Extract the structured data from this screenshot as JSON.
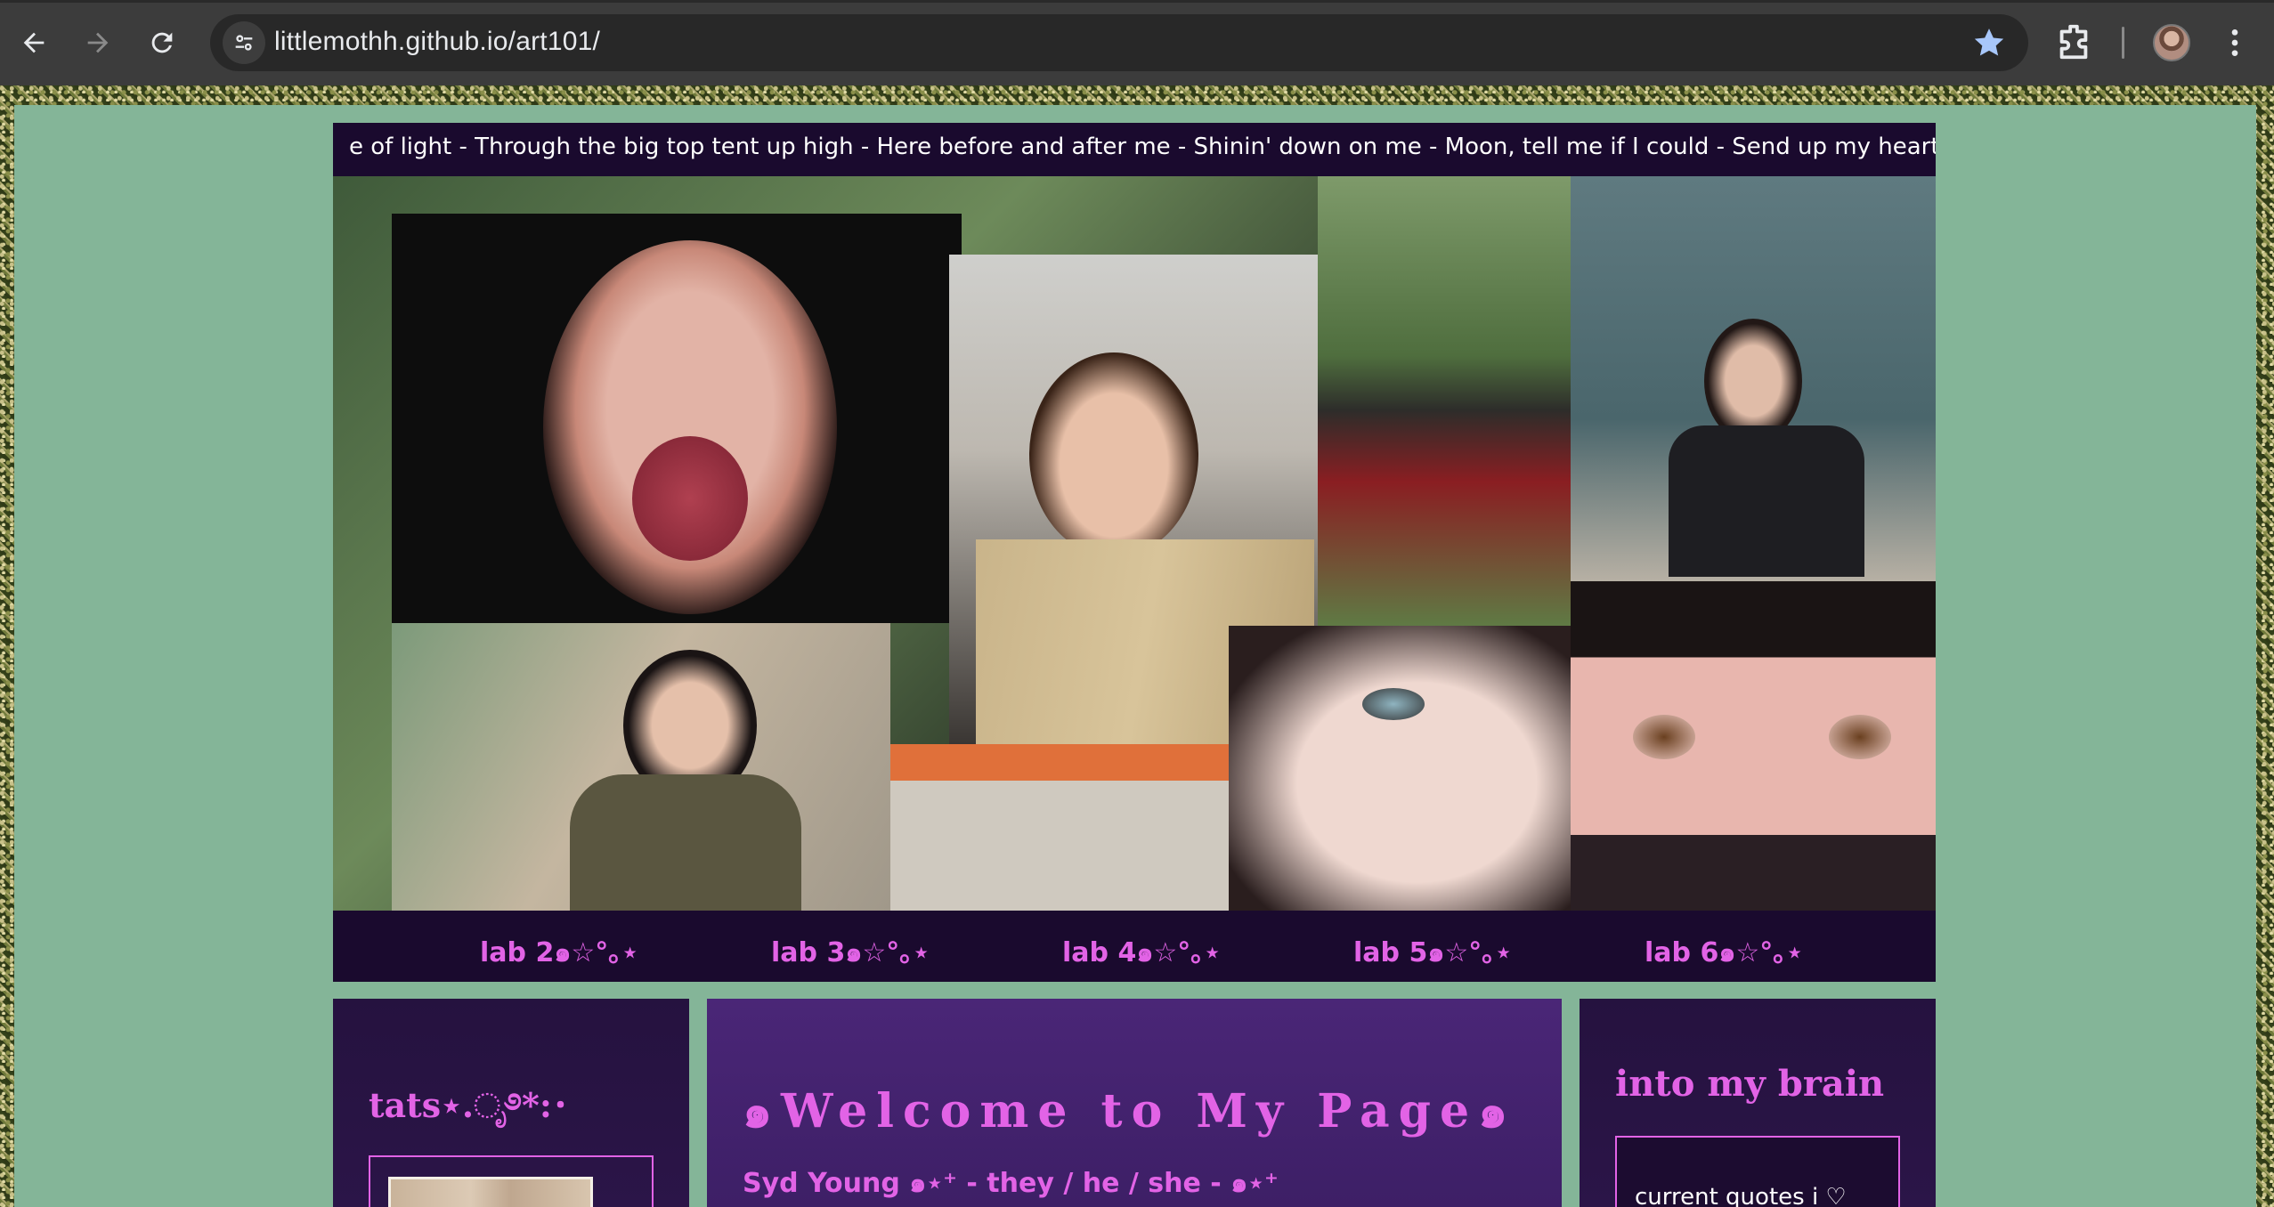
{
  "browser": {
    "url": "littlemothh.github.io/art101/",
    "icons": {
      "back": "back-arrow-icon",
      "forward": "forward-arrow-icon",
      "reload": "reload-icon",
      "site_info": "tune-icon",
      "bookmark": "star-icon",
      "extensions": "puzzle-icon",
      "profile": "avatar",
      "menu": "kebab-menu-icon"
    }
  },
  "page": {
    "marquee_text": "e of light - Through the big top tent up high - Here before and after me - Shinin' down on me - Moon, tell me if I could - Send up my heart to you? - S",
    "lab_links": [
      {
        "label": "lab 2๑☆°｡⋆"
      },
      {
        "label": "lab 3๑☆°｡⋆"
      },
      {
        "label": "lab 4๑☆°｡⋆"
      },
      {
        "label": "lab 5๑☆°｡⋆"
      },
      {
        "label": "lab 6๑☆°｡⋆"
      }
    ],
    "left_panel": {
      "title": "tats⋆.ೃ࿔*:･"
    },
    "main_panel": {
      "title": "๑Welcome to My Page๑",
      "subtitle": "Syd Young ๑⋆⁺ - they / he / she - ๑⋆⁺"
    },
    "right_panel": {
      "title": "into my brain",
      "quotes_label": "current quotes i ♡"
    },
    "colors": {
      "page_bg": "#84b598",
      "accent_pink": "#e263e6",
      "dark_purple": "#1a0a2e",
      "mid_purple": "#4a2677"
    }
  }
}
